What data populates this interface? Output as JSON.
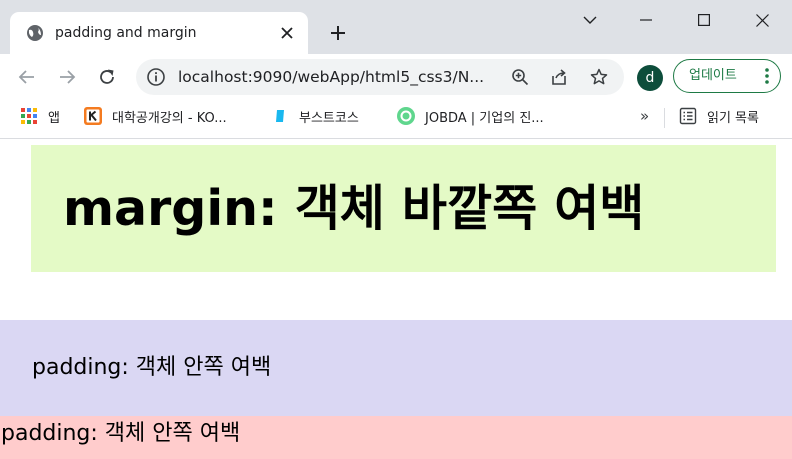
{
  "browser": {
    "tab": {
      "title": "padding and margin"
    },
    "address_bar": {
      "url": "localhost:9090/webApp/html5_css3/N..."
    },
    "profile": {
      "initial": "d"
    },
    "update_button": {
      "label": "업데이트"
    },
    "bookmarks": {
      "items": [
        {
          "label": "앱"
        },
        {
          "label": "대학공개강의 - KO..."
        },
        {
          "label": "부스트코스"
        },
        {
          "label": "JOBDA | 기업의 진..."
        }
      ],
      "overflow": "»",
      "reading_list": "읽기 목록"
    }
  },
  "page": {
    "margin_heading": "margin: 객체 바깥쪽 여백",
    "padding_text": "padding: 객체 안쪽 여백",
    "plain_text": "padding: 객체 안쪽 여백"
  },
  "colors": {
    "margin_bg": "#e4fac6",
    "padding_bg": "#dad7f3",
    "plain_bg": "#ffcccc"
  }
}
